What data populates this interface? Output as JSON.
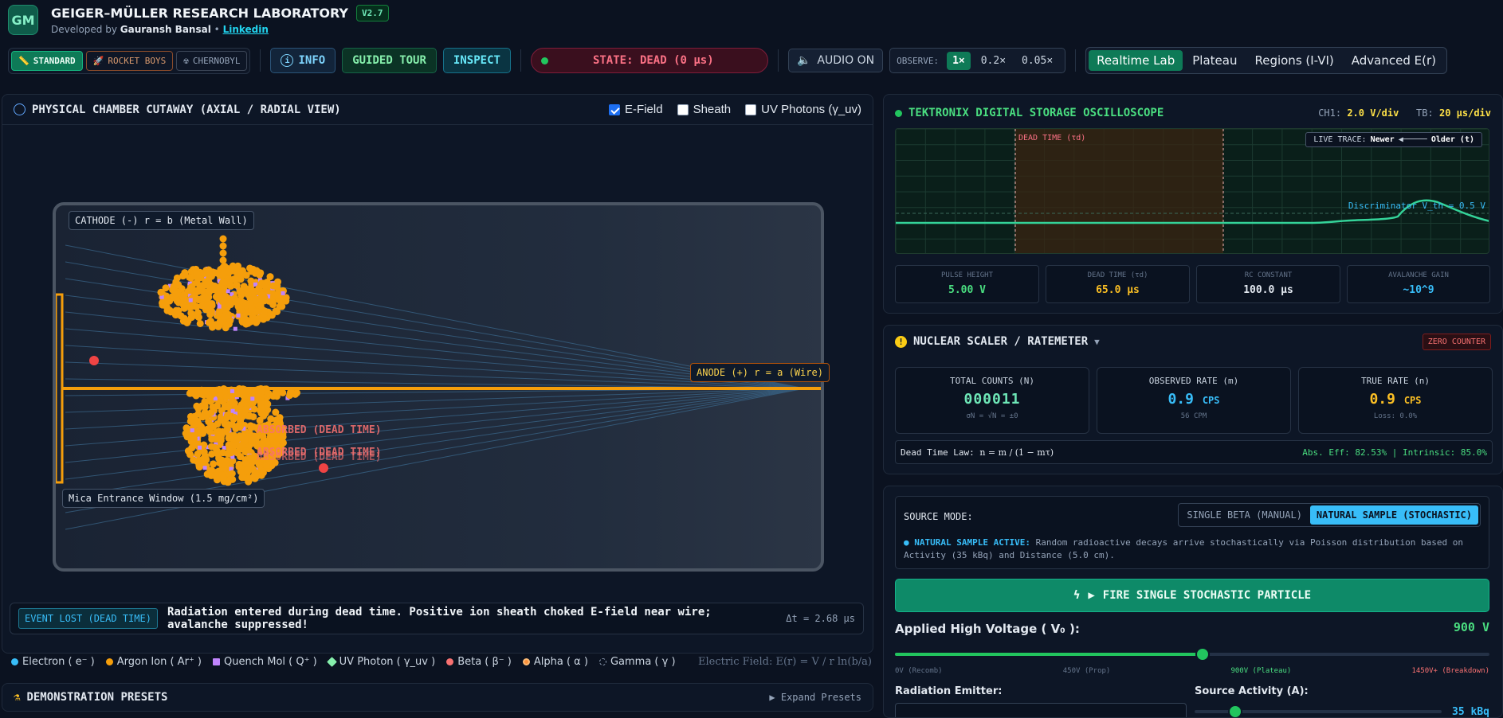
{
  "app": {
    "logo": "GM",
    "title": "GEIGER–MÜLLER RESEARCH LABORATORY",
    "version": "V2.7",
    "dev_prefix": "Developed by",
    "dev_name": "Gauransh Bansal",
    "sep": "•",
    "link": "Linkedin"
  },
  "toolbar": {
    "presets": [
      {
        "label": "STANDARD",
        "icon": "ruler-icon",
        "active": true
      },
      {
        "label": "ROCKET BOYS",
        "icon": "rocket-icon",
        "active": false
      },
      {
        "label": "CHERNOBYL",
        "icon": "radiation-icon",
        "active": false
      }
    ],
    "info": "INFO",
    "tour": "GUIDED TOUR",
    "inspect": "INSPECT",
    "state": "STATE: DEAD (0 μs)",
    "audio": "AUDIO ON",
    "observe_label": "OBSERVE:",
    "observe": [
      "1×",
      "0.2×",
      "0.05×"
    ],
    "views": [
      "Realtime Lab",
      "Plateau",
      "Regions (I-VI)",
      "Advanced E(r)"
    ]
  },
  "chamber": {
    "title": "PHYSICAL CHAMBER CUTAWAY (AXIAL / RADIAL VIEW)",
    "toggles": [
      {
        "label": "E-Field",
        "checked": true
      },
      {
        "label": "Sheath",
        "checked": false
      },
      {
        "label": "UV Photons (γ_uv)",
        "checked": false
      }
    ],
    "cathode": "CATHODE (-) r = b (Metal Wall)",
    "anode": "ANODE (+) r = a (Wire)",
    "mica": "Mica Entrance Window (1.5 mg/cm²)",
    "ghost_label": "ABSORBED (DEAD TIME)",
    "event_badge": "EVENT LOST (DEAD TIME)",
    "event_msg": "Radiation entered during dead time. Positive ion sheath choked E-field near wire; avalanche suppressed!",
    "event_dt": "Δt = 2.68 μs"
  },
  "legend": [
    {
      "label": "Electron ( e⁻ )",
      "color": "#38bdf8"
    },
    {
      "label": "Argon Ion ( Ar⁺ )",
      "color": "#f59e0b"
    },
    {
      "label": "Quench Mol ( Q⁺ )",
      "color": "#c084fc"
    },
    {
      "label": "UV Photon ( γ_uv )",
      "color": "#86efac"
    },
    {
      "label": "Beta ( β⁻ )",
      "color": "#f87171"
    },
    {
      "label": "Alpha ( α )",
      "color": "#fb923c"
    },
    {
      "label": "Gamma ( γ )",
      "color": "#94a3b8"
    }
  ],
  "efield": "Electric Field: E(r) = V / r ln(b/a)",
  "presets_title": "DEMONSTRATION PRESETS",
  "presets_expand": "Expand Presets",
  "scope": {
    "title": "TEKTRONIX DIGITAL STORAGE OSCILLOSCOPE",
    "ch1_label": "CH1:",
    "ch1": "2.0 V/div",
    "tb_label": "TB:",
    "tb": "20 μs/div",
    "dead_label": "DEAD TIME (τd)",
    "live_trace": "LIVE TRACE:",
    "newer": "Newer",
    "older": "Older (t)",
    "discriminator": "Discriminator V_th = 0.5 V",
    "measures": [
      {
        "label": "PULSE HEIGHT",
        "value": "5.00 V",
        "color": "#4ade80"
      },
      {
        "label": "DEAD TIME (τd)",
        "value": "65.0 μs",
        "color": "#fbbf24"
      },
      {
        "label": "RC CONSTANT",
        "value": "100.0 μs",
        "color": "#e2e8f0"
      },
      {
        "label": "AVALANCHE GAIN",
        "value": "~10^9",
        "color": "#38bdf8"
      }
    ]
  },
  "scaler": {
    "title": "NUCLEAR SCALER / RATEMETER",
    "zero": "ZERO COUNTER",
    "total_label": "TOTAL COUNTS (N)",
    "total": "000011",
    "total_sub": "σN = √N = ±0",
    "obs_label": "OBSERVED RATE (m)",
    "obs_value": "0.9",
    "obs_unit": "CPS",
    "obs_sub": "56 CPM",
    "true_label": "TRUE RATE (n)",
    "true_value": "0.9",
    "true_unit": "CPS",
    "true_sub": "Loss: 0.0%",
    "law_label": "Dead Time Law:",
    "law": "n = m / (1 − mτ)",
    "eff": "Abs. Eff: 82.53% | Intrinsic: 85.0%"
  },
  "controls": {
    "source_mode_label": "SOURCE MODE:",
    "mode_single": "SINGLE BETA (MANUAL)",
    "mode_natural": "NATURAL SAMPLE (STOCHASTIC)",
    "natural_head": "● NATURAL SAMPLE ACTIVE:",
    "natural_text": "Random radioactive decays arrive stochastically via Poisson distribution based on Activity (35 kBq) and Distance (5.0 cm).",
    "fire": "FIRE SINGLE STOCHASTIC PARTICLE",
    "hv_label": "Applied High Voltage ( V₀ ):",
    "hv_value": "900 V",
    "hv_level": 0.517,
    "hv_ticks": [
      "0V (Recomb)",
      "450V (Prop)",
      "900V (Plateau)",
      "1450V+ (Breakdown)"
    ],
    "emitter_label": "Radiation Emitter:",
    "activity_label": "Source Activity (A):",
    "activity_value": "35 kBq"
  }
}
